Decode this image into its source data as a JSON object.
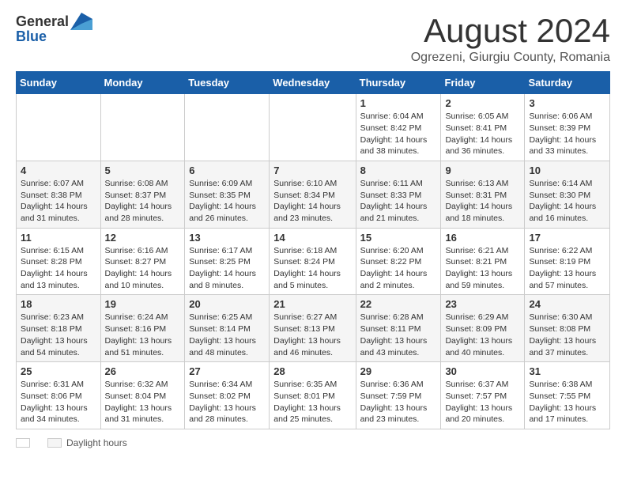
{
  "header": {
    "logo_general": "General",
    "logo_blue": "Blue",
    "month_year": "August 2024",
    "location": "Ogrezeni, Giurgiu County, Romania"
  },
  "weekdays": [
    "Sunday",
    "Monday",
    "Tuesday",
    "Wednesday",
    "Thursday",
    "Friday",
    "Saturday"
  ],
  "weeks": [
    [
      {
        "day": "",
        "info": ""
      },
      {
        "day": "",
        "info": ""
      },
      {
        "day": "",
        "info": ""
      },
      {
        "day": "",
        "info": ""
      },
      {
        "day": "1",
        "info": "Sunrise: 6:04 AM\nSunset: 8:42 PM\nDaylight: 14 hours\nand 38 minutes."
      },
      {
        "day": "2",
        "info": "Sunrise: 6:05 AM\nSunset: 8:41 PM\nDaylight: 14 hours\nand 36 minutes."
      },
      {
        "day": "3",
        "info": "Sunrise: 6:06 AM\nSunset: 8:39 PM\nDaylight: 14 hours\nand 33 minutes."
      }
    ],
    [
      {
        "day": "4",
        "info": "Sunrise: 6:07 AM\nSunset: 8:38 PM\nDaylight: 14 hours\nand 31 minutes."
      },
      {
        "day": "5",
        "info": "Sunrise: 6:08 AM\nSunset: 8:37 PM\nDaylight: 14 hours\nand 28 minutes."
      },
      {
        "day": "6",
        "info": "Sunrise: 6:09 AM\nSunset: 8:35 PM\nDaylight: 14 hours\nand 26 minutes."
      },
      {
        "day": "7",
        "info": "Sunrise: 6:10 AM\nSunset: 8:34 PM\nDaylight: 14 hours\nand 23 minutes."
      },
      {
        "day": "8",
        "info": "Sunrise: 6:11 AM\nSunset: 8:33 PM\nDaylight: 14 hours\nand 21 minutes."
      },
      {
        "day": "9",
        "info": "Sunrise: 6:13 AM\nSunset: 8:31 PM\nDaylight: 14 hours\nand 18 minutes."
      },
      {
        "day": "10",
        "info": "Sunrise: 6:14 AM\nSunset: 8:30 PM\nDaylight: 14 hours\nand 16 minutes."
      }
    ],
    [
      {
        "day": "11",
        "info": "Sunrise: 6:15 AM\nSunset: 8:28 PM\nDaylight: 14 hours\nand 13 minutes."
      },
      {
        "day": "12",
        "info": "Sunrise: 6:16 AM\nSunset: 8:27 PM\nDaylight: 14 hours\nand 10 minutes."
      },
      {
        "day": "13",
        "info": "Sunrise: 6:17 AM\nSunset: 8:25 PM\nDaylight: 14 hours\nand 8 minutes."
      },
      {
        "day": "14",
        "info": "Sunrise: 6:18 AM\nSunset: 8:24 PM\nDaylight: 14 hours\nand 5 minutes."
      },
      {
        "day": "15",
        "info": "Sunrise: 6:20 AM\nSunset: 8:22 PM\nDaylight: 14 hours\nand 2 minutes."
      },
      {
        "day": "16",
        "info": "Sunrise: 6:21 AM\nSunset: 8:21 PM\nDaylight: 13 hours\nand 59 minutes."
      },
      {
        "day": "17",
        "info": "Sunrise: 6:22 AM\nSunset: 8:19 PM\nDaylight: 13 hours\nand 57 minutes."
      }
    ],
    [
      {
        "day": "18",
        "info": "Sunrise: 6:23 AM\nSunset: 8:18 PM\nDaylight: 13 hours\nand 54 minutes."
      },
      {
        "day": "19",
        "info": "Sunrise: 6:24 AM\nSunset: 8:16 PM\nDaylight: 13 hours\nand 51 minutes."
      },
      {
        "day": "20",
        "info": "Sunrise: 6:25 AM\nSunset: 8:14 PM\nDaylight: 13 hours\nand 48 minutes."
      },
      {
        "day": "21",
        "info": "Sunrise: 6:27 AM\nSunset: 8:13 PM\nDaylight: 13 hours\nand 46 minutes."
      },
      {
        "day": "22",
        "info": "Sunrise: 6:28 AM\nSunset: 8:11 PM\nDaylight: 13 hours\nand 43 minutes."
      },
      {
        "day": "23",
        "info": "Sunrise: 6:29 AM\nSunset: 8:09 PM\nDaylight: 13 hours\nand 40 minutes."
      },
      {
        "day": "24",
        "info": "Sunrise: 6:30 AM\nSunset: 8:08 PM\nDaylight: 13 hours\nand 37 minutes."
      }
    ],
    [
      {
        "day": "25",
        "info": "Sunrise: 6:31 AM\nSunset: 8:06 PM\nDaylight: 13 hours\nand 34 minutes."
      },
      {
        "day": "26",
        "info": "Sunrise: 6:32 AM\nSunset: 8:04 PM\nDaylight: 13 hours\nand 31 minutes."
      },
      {
        "day": "27",
        "info": "Sunrise: 6:34 AM\nSunset: 8:02 PM\nDaylight: 13 hours\nand 28 minutes."
      },
      {
        "day": "28",
        "info": "Sunrise: 6:35 AM\nSunset: 8:01 PM\nDaylight: 13 hours\nand 25 minutes."
      },
      {
        "day": "29",
        "info": "Sunrise: 6:36 AM\nSunset: 7:59 PM\nDaylight: 13 hours\nand 23 minutes."
      },
      {
        "day": "30",
        "info": "Sunrise: 6:37 AM\nSunset: 7:57 PM\nDaylight: 13 hours\nand 20 minutes."
      },
      {
        "day": "31",
        "info": "Sunrise: 6:38 AM\nSunset: 7:55 PM\nDaylight: 13 hours\nand 17 minutes."
      }
    ]
  ],
  "footer": {
    "daylight_label": "Daylight hours"
  }
}
